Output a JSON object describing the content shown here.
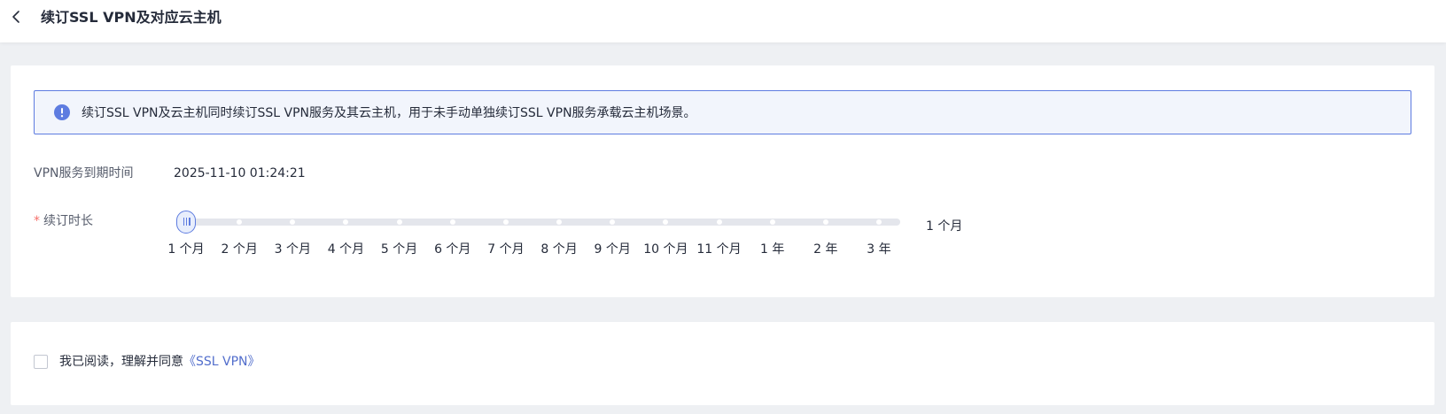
{
  "header": {
    "title": "续订SSL VPN及对应云主机"
  },
  "info": {
    "text": "续订SSL VPN及云主机同时续订SSL VPN服务及其云主机，用于未手动单独续订SSL VPN服务承载云主机场景。"
  },
  "expiry": {
    "label": "VPN服务到期时间",
    "value": "2025-11-10 01:24:21"
  },
  "duration": {
    "required_mark": "*",
    "label": "续订时长",
    "selected_value": "1 个月",
    "selected_index": 0,
    "options": [
      "1 个月",
      "2 个月",
      "3 个月",
      "4 个月",
      "5 个月",
      "6 个月",
      "7 个月",
      "8 个月",
      "9 个月",
      "10 个月",
      "11 个月",
      "1 年",
      "2 年",
      "3 年"
    ]
  },
  "agreement": {
    "text": "我已阅读，理解并同意",
    "link": "《SSL VPN》",
    "checked": false
  },
  "colors": {
    "accent": "#5e7ce0",
    "link": "#526ecc",
    "required": "#f66f6a",
    "banner_bg": "#f2f5fc",
    "page_bg": "#eef0f3"
  },
  "icons": {
    "back": "chevron-left-icon",
    "info": "info-circle-icon"
  }
}
